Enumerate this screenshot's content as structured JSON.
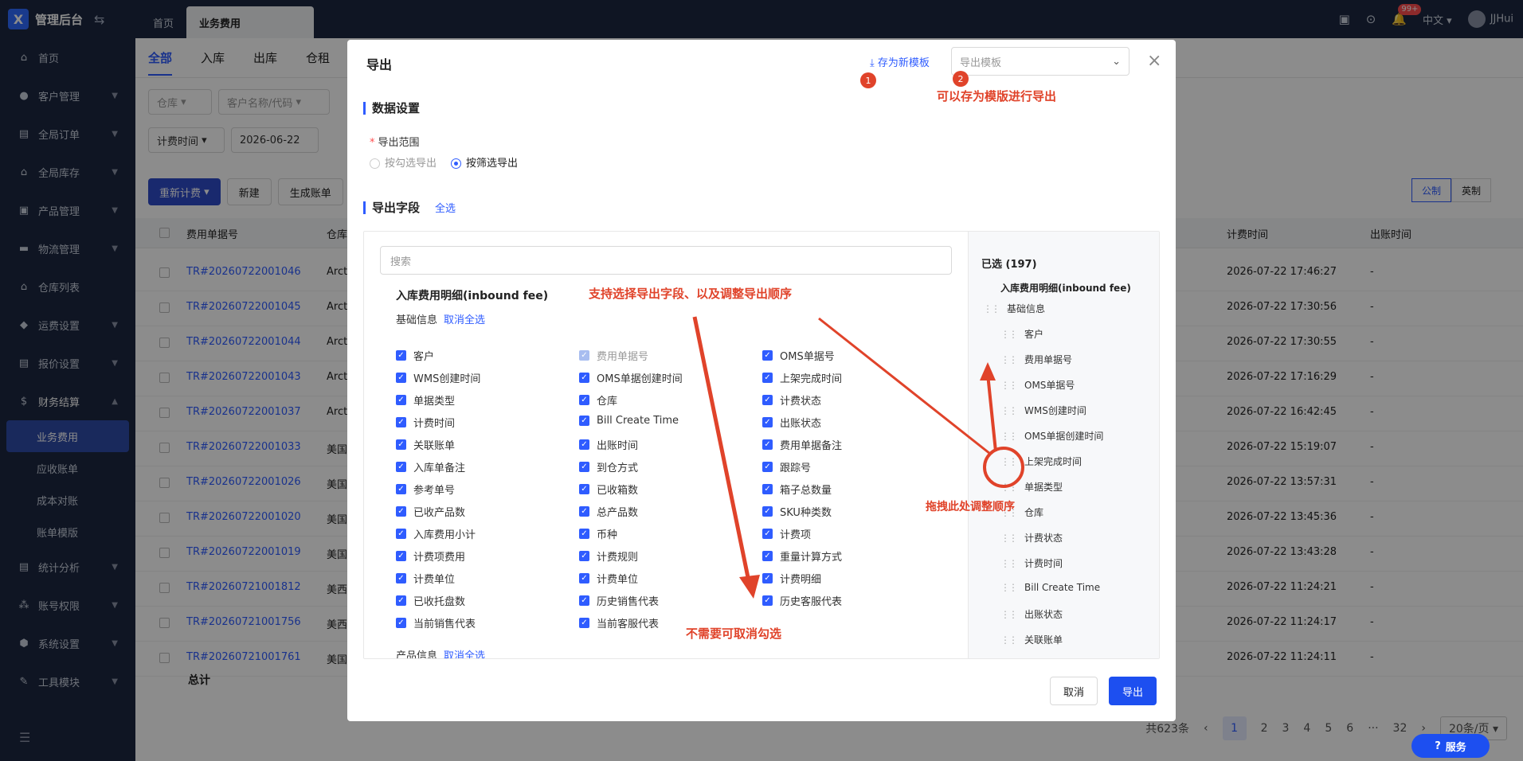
{
  "app": {
    "logo": "X",
    "title": "管理后台"
  },
  "top_tabs": [
    {
      "label": "首页"
    },
    {
      "label": "业务费用"
    }
  ],
  "top_right": {
    "badge": "99+",
    "lang": "中文",
    "user": "JJHui"
  },
  "sidebar": {
    "items": [
      {
        "label": "首页",
        "icon": "home-icon"
      },
      {
        "label": "客户管理",
        "icon": "user-icon"
      },
      {
        "label": "全局订单",
        "icon": "order-icon"
      },
      {
        "label": "全局库存",
        "icon": "inventory-icon"
      },
      {
        "label": "产品管理",
        "icon": "product-icon"
      },
      {
        "label": "物流管理",
        "icon": "truck-icon"
      },
      {
        "label": "仓库列表",
        "icon": "warehouse-icon"
      },
      {
        "label": "运费设置",
        "icon": "freight-icon"
      },
      {
        "label": "报价设置",
        "icon": "quote-icon"
      },
      {
        "label": "财务结算",
        "icon": "finance-icon"
      }
    ],
    "finance_sub": [
      {
        "label": "业务费用"
      },
      {
        "label": "应收账单"
      },
      {
        "label": "成本对账"
      },
      {
        "label": "账单模版"
      }
    ],
    "bottom_items": [
      {
        "label": "统计分析",
        "icon": "stats-icon"
      },
      {
        "label": "账号权限",
        "icon": "permission-icon"
      },
      {
        "label": "系统设置",
        "icon": "settings-icon"
      },
      {
        "label": "工具模块",
        "icon": "tools-icon"
      }
    ]
  },
  "main": {
    "sub_tabs": [
      "全部",
      "入库",
      "出库",
      "仓租"
    ],
    "filters": {
      "warehouse": "仓库",
      "customer": "客户名称/代码",
      "time_type": "计费时间",
      "date_start": "2026-06-22"
    },
    "buttons": {
      "recalc": "重新计费",
      "new": "新建",
      "gen_bill": "生成账单"
    },
    "unit_toggle": [
      "公制",
      "英制"
    ],
    "columns": {
      "fee_no": "费用单据号",
      "warehouse": "仓库",
      "bill_time": "计费时间",
      "out_time": "出账时间"
    },
    "rows": [
      {
        "no": "TR#20260722001046",
        "wh": "Arcti",
        "time": "2026-07-22 17:46:27",
        "out": "-"
      },
      {
        "no": "TR#20260722001045",
        "wh": "Arcti",
        "time": "2026-07-22 17:30:56",
        "out": "-"
      },
      {
        "no": "TR#20260722001044",
        "wh": "Arcti",
        "time": "2026-07-22 17:30:55",
        "out": "-"
      },
      {
        "no": "TR#20260722001043",
        "wh": "Arcti",
        "time": "2026-07-22 17:16:29",
        "out": "-"
      },
      {
        "no": "TR#20260722001037",
        "wh": "Arcti",
        "time": "2026-07-22 16:42:45",
        "out": "-"
      },
      {
        "no": "TR#20260722001033",
        "wh": "美国",
        "time": "2026-07-22 15:19:07",
        "out": "-"
      },
      {
        "no": "TR#20260722001026",
        "wh": "美国",
        "time": "2026-07-22 13:57:31",
        "out": "-"
      },
      {
        "no": "TR#20260722001020",
        "wh": "美国",
        "time": "2026-07-22 13:45:36",
        "out": "-"
      },
      {
        "no": "TR#20260722001019",
        "wh": "美国",
        "time": "2026-07-22 13:43:28",
        "out": "-"
      },
      {
        "no": "TR#20260721001812",
        "wh": "美西",
        "time": "2026-07-22 11:24:21",
        "out": "-"
      },
      {
        "no": "TR#20260721001756",
        "wh": "美西",
        "time": "2026-07-22 11:24:17",
        "out": "-"
      },
      {
        "no": "TR#20260721001761",
        "wh": "美国",
        "time": "2026-07-22 11:24:11",
        "out": "-"
      }
    ],
    "total_label": "总计",
    "pager": {
      "total": "共623条",
      "pages": [
        "1",
        "2",
        "3",
        "4",
        "5",
        "6",
        "···",
        "32"
      ],
      "page_size": "20条/页"
    }
  },
  "modal": {
    "title": "导出",
    "save_template": "存为新模板",
    "template_placeholder": "导出模板",
    "data_settings": "数据设置",
    "range_label": "导出范围",
    "range_options": [
      "按勾选导出",
      "按筛选导出"
    ],
    "fields_title": "导出字段",
    "select_all": "全选",
    "search_placeholder": "搜索",
    "group_title": "入库费用明细(inbound fee)",
    "basic_info": "基础信息",
    "product_info": "产品信息",
    "cancel_select": "取消全选",
    "fields_col1": [
      "客户",
      "WMS创建时间",
      "单据类型",
      "计费时间",
      "关联账单",
      "入库单备注",
      "参考单号",
      "已收产品数",
      "入库费用小计",
      "计费项费用",
      "计费单位",
      "已收托盘数",
      "当前销售代表"
    ],
    "fields_col2": [
      "费用单据号",
      "OMS单据创建时间",
      "仓库",
      "Bill Create Time",
      "出账时间",
      "到仓方式",
      "已收箱数",
      "总产品数",
      "币种",
      "计费规则",
      "计费单位",
      "历史销售代表",
      "当前客服代表"
    ],
    "fields_col3": [
      "OMS单据号",
      "上架完成时间",
      "计费状态",
      "出账状态",
      "费用单据备注",
      "跟踪号",
      "箱子总数量",
      "SKU种类数",
      "计费项",
      "重量计算方式",
      "计费明细",
      "历史客服代表"
    ],
    "selected_count": "已选 (197)",
    "selected_group": "入库费用明细(inbound fee)",
    "selected_sub": "基础信息",
    "selected_items": [
      "客户",
      "费用单据号",
      "OMS单据号",
      "WMS创建时间",
      "OMS单据创建时间",
      "上架完成时间",
      "单据类型",
      "仓库",
      "计费状态",
      "计费时间",
      "Bill Create Time",
      "出账状态",
      "关联账单"
    ],
    "cancel": "取消",
    "export": "导出"
  },
  "annotations": {
    "n1": "1",
    "n2": "2",
    "save_hint": "可以存为模版进行导出",
    "fields_hint": "支持选择导出字段、以及调整导出顺序",
    "drag_hint": "拖拽此处调整顺序",
    "uncheck_hint": "不需要可取消勾选"
  },
  "service": "服务",
  "colors": {
    "primary": "#2f5cff",
    "annotation": "#e0432a",
    "nav_bg": "#1c2740"
  }
}
